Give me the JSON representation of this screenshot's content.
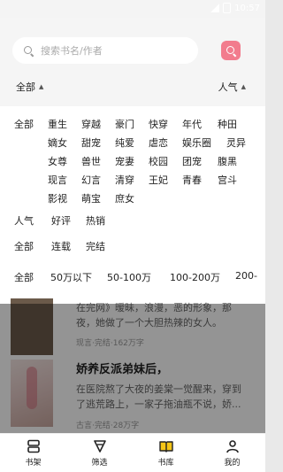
{
  "status": {
    "time": "10:57"
  },
  "search": {
    "placeholder": "搜索书名/作者"
  },
  "sort": {
    "left_label": "全部",
    "right_label": "人气"
  },
  "filters": {
    "genres": [
      "全部",
      "重生",
      "穿越",
      "豪门",
      "快穿",
      "年代",
      "种田",
      "嫡女",
      "甜宠",
      "纯爱",
      "虐恋",
      "娱乐圈",
      "灵异",
      "女尊",
      "兽世",
      "宠妻",
      "校园",
      "团宠",
      "腹黑",
      "现言",
      "幻言",
      "清穿",
      "王妃",
      "青春",
      "宫斗",
      "影视",
      "萌宝",
      "庶女"
    ],
    "sort_options": [
      "人气",
      "好评",
      "热销"
    ],
    "status_options": [
      "全部",
      "连载",
      "完结"
    ],
    "word_counts": [
      "全部",
      "50万以下",
      "50-100万",
      "100-200万",
      "200-"
    ]
  },
  "books": [
    {
      "title": "",
      "desc_lines": [
        "在完网》暧昧，浪漫，恶的形象，那",
        "夜，她做了一个大胆热辣的女人。"
      ],
      "meta": "现言·完结·162万字"
    },
    {
      "title": "娇养反派弟妹后，",
      "desc_lines": [
        "在医院熬了大夜的姜棠一觉醒来，穿到",
        "了逃荒路上，一家子拖油瓶不说，娇..."
      ],
      "meta": "古言·完结·28万字"
    }
  ],
  "tabs": [
    {
      "label": "书架",
      "icon": "bookshelf-icon"
    },
    {
      "label": "筛选",
      "icon": "filter-icon"
    },
    {
      "label": "书库",
      "icon": "library-icon"
    },
    {
      "label": "我的",
      "icon": "profile-icon"
    }
  ],
  "colors": {
    "accent": "#f27c8d",
    "highlight": "#f5c518"
  }
}
